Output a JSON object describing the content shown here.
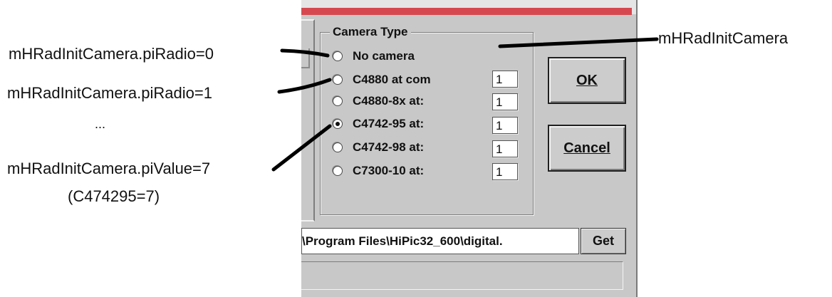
{
  "annotations": {
    "radio0": "mHRadInitCamera.piRadio=0",
    "radio1": "mHRadInitCamera.piRadio=1",
    "ellipsis": "...",
    "value7": "mHRadInitCamera.piValue=7",
    "mapping": "(C474295=7)",
    "camera": "mHRadInitCamera"
  },
  "dialog": {
    "group_title": "Camera Type",
    "radios": [
      {
        "label": "No camera",
        "checked": false,
        "port": ""
      },
      {
        "label": "C4880 at com",
        "checked": false,
        "port": "1"
      },
      {
        "label": "C4880-8x at:",
        "checked": false,
        "port": "1"
      },
      {
        "label": "C4742-95 at:",
        "checked": true,
        "port": "1"
      },
      {
        "label": "C4742-98 at:",
        "checked": false,
        "port": "1"
      },
      {
        "label": "C7300-10 at:",
        "checked": false,
        "port": "1"
      }
    ],
    "ok_label": "OK",
    "cancel_label": "Cancel",
    "path_value": "\\Program Files\\HiPic32_600\\digital.",
    "get_label": "Get"
  },
  "colors": {
    "title_bar": "#d6484f",
    "dialog_face": "#c8c8c8"
  }
}
